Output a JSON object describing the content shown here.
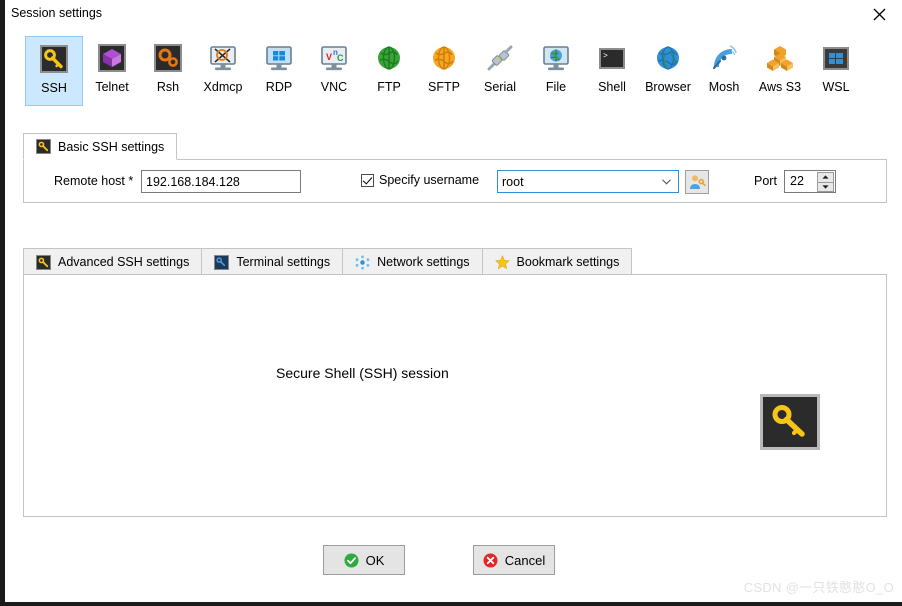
{
  "window": {
    "title": "Session settings",
    "close_label": "×"
  },
  "session_types": [
    {
      "id": "ssh",
      "label": "SSH",
      "icon": "ssh-key-icon",
      "selected": true
    },
    {
      "id": "telnet",
      "label": "Telnet",
      "icon": "telnet-cube-icon",
      "selected": false
    },
    {
      "id": "rsh",
      "label": "Rsh",
      "icon": "rsh-gears-icon",
      "selected": false
    },
    {
      "id": "xdmcp",
      "label": "Xdmcp",
      "icon": "xdmcp-monitor-icon",
      "selected": false
    },
    {
      "id": "rdp",
      "label": "RDP",
      "icon": "rdp-windows-icon",
      "selected": false
    },
    {
      "id": "vnc",
      "label": "VNC",
      "icon": "vnc-monitor-icon",
      "selected": false
    },
    {
      "id": "ftp",
      "label": "FTP",
      "icon": "ftp-globe-icon",
      "selected": false
    },
    {
      "id": "sftp",
      "label": "SFTP",
      "icon": "sftp-globe-icon",
      "selected": false
    },
    {
      "id": "serial",
      "label": "Serial",
      "icon": "serial-plug-icon",
      "selected": false
    },
    {
      "id": "file",
      "label": "File",
      "icon": "file-monitor-icon",
      "selected": false
    },
    {
      "id": "shell",
      "label": "Shell",
      "icon": "shell-terminal-icon",
      "selected": false
    },
    {
      "id": "browser",
      "label": "Browser",
      "icon": "browser-globe-icon",
      "selected": false
    },
    {
      "id": "mosh",
      "label": "Mosh",
      "icon": "mosh-satellite-icon",
      "selected": false
    },
    {
      "id": "aws_s3",
      "label": "Aws S3",
      "icon": "aws-s3-buckets-icon",
      "selected": false
    },
    {
      "id": "wsl",
      "label": "WSL",
      "icon": "wsl-windows-icon",
      "selected": false
    }
  ],
  "basic_group": {
    "tab_label": "Basic SSH settings",
    "tab_icon": "key-icon",
    "remote_host_label": "Remote host *",
    "remote_host_value": "192.168.184.128",
    "remote_host_placeholder": "",
    "specify_username_label": "Specify username",
    "specify_username_checked": true,
    "username_value": "root",
    "username_placeholder": "",
    "user_key_button_icon": "user-key-icon",
    "port_label": "Port",
    "port_value": "22"
  },
  "lower_tabs": [
    {
      "id": "advanced_ssh",
      "label": "Advanced SSH settings",
      "icon": "key-icon",
      "active": false
    },
    {
      "id": "terminal",
      "label": "Terminal settings",
      "icon": "terminal-icon",
      "active": false
    },
    {
      "id": "network",
      "label": "Network settings",
      "icon": "network-icon",
      "active": false
    },
    {
      "id": "bookmark",
      "label": "Bookmark settings",
      "icon": "star-icon",
      "active": false
    }
  ],
  "content_panel": {
    "description": "Secure Shell (SSH) session",
    "big_icon": "ssh-key-icon"
  },
  "footer": {
    "ok_label": "OK",
    "ok_icon": "check-circle-icon",
    "cancel_label": "Cancel",
    "cancel_icon": "x-circle-icon"
  },
  "watermark": "CSDN @一只铁憨憨O_O",
  "colors": {
    "selection_fill": "#cce8ff",
    "selection_border": "#9ac8ec",
    "focus_border": "#2f8fd8",
    "panel_border": "#c4c4c4",
    "button_face": "#e4e4e4",
    "ok_green": "#2faa41",
    "cancel_red": "#e0282a",
    "key_yellow": "#f5c518"
  }
}
